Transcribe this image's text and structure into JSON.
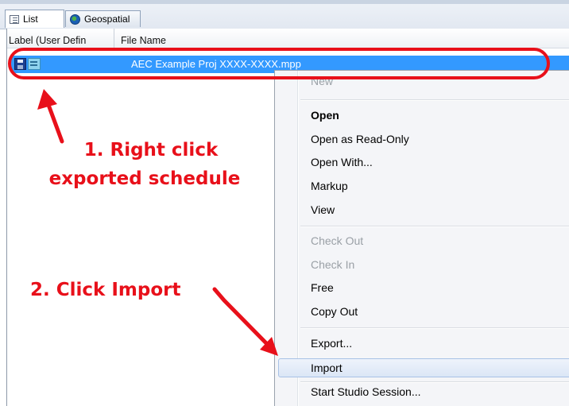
{
  "tabs": [
    {
      "label": "List",
      "icon": "list-icon",
      "active": true
    },
    {
      "label": "Geospatial",
      "icon": "globe-icon",
      "active": false
    }
  ],
  "columns": {
    "label": "Label (User Defin",
    "file_name": "File Name"
  },
  "selected_row": {
    "file_name": "AEC Example Proj XXXX-XXXX.mpp",
    "icons": [
      "save-icon",
      "schedule-icon"
    ],
    "highlight_color": "#3399ff"
  },
  "context_menu": {
    "new": "New",
    "open": "Open",
    "open_read_only": "Open as Read-Only",
    "open_with": "Open With...",
    "markup": "Markup",
    "view": "View",
    "check_out": "Check Out",
    "check_in": "Check In",
    "free": "Free",
    "copy_out": "Copy Out",
    "export": "Export...",
    "import": "Import",
    "start_studio_session": "Start Studio Session..."
  },
  "annotations": {
    "step1_line1": "1. Right click",
    "step1_line2": "exported schedule",
    "step2": "2. Click Import",
    "color": "#e8101a"
  }
}
